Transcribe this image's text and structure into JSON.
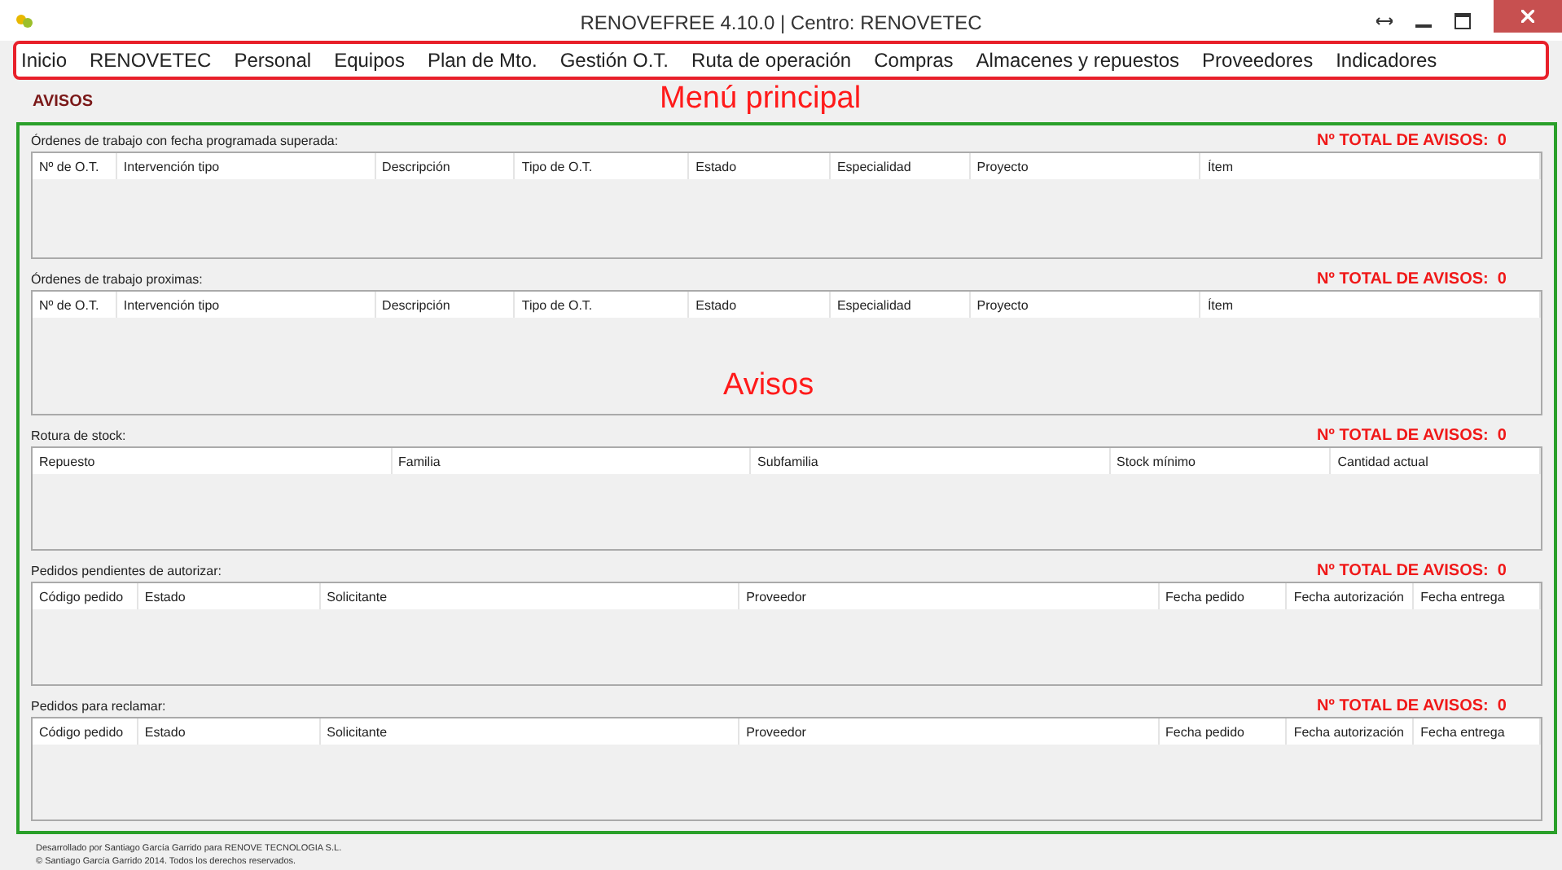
{
  "window": {
    "title": "RENOVEFREE 4.10.0 | Centro: RENOVETEC"
  },
  "menu": [
    "Inicio",
    "RENOVETEC",
    "Personal",
    "Equipos",
    "Plan de Mto.",
    "Gestión O.T.",
    "Ruta de operación",
    "Compras",
    "Almacenes y repuestos",
    "Proveedores",
    "Indicadores"
  ],
  "annotations": {
    "menu": "Menú principal",
    "panel": "Avisos"
  },
  "page_title": "AVISOS",
  "sections": [
    {
      "title": "Órdenes de trabajo con fecha programada superada:",
      "total_label": "Nº TOTAL DE AVISOS:",
      "total": "0",
      "columns": [
        "Nº de O.T.",
        "Intervención tipo",
        "Descripción",
        "Tipo de O.T.",
        "Estado",
        "Especialidad",
        "Proyecto",
        "Ítem"
      ]
    },
    {
      "title": "Órdenes de trabajo proximas:",
      "total_label": "Nº TOTAL DE AVISOS:",
      "total": "0",
      "columns": [
        "Nº de O.T.",
        "Intervención tipo",
        "Descripción",
        "Tipo de O.T.",
        "Estado",
        "Especialidad",
        "Proyecto",
        "Ítem"
      ]
    },
    {
      "title": "Rotura de stock:",
      "total_label": "Nº TOTAL DE AVISOS:",
      "total": "0",
      "columns": [
        "Repuesto",
        "Familia",
        "Subfamilia",
        "Stock mínimo",
        "Cantidad actual"
      ]
    },
    {
      "title": "Pedidos pendientes de autorizar:",
      "total_label": "Nº TOTAL DE AVISOS:",
      "total": "0",
      "columns": [
        "Código pedido",
        "Estado",
        "Solicitante",
        "Proveedor",
        "Fecha pedido",
        "Fecha autorización",
        "Fecha entrega"
      ]
    },
    {
      "title": "Pedidos para reclamar:",
      "total_label": "Nº TOTAL DE AVISOS:",
      "total": "0",
      "columns": [
        "Código pedido",
        "Estado",
        "Solicitante",
        "Proveedor",
        "Fecha pedido",
        "Fecha autorización",
        "Fecha entrega"
      ]
    }
  ],
  "footer": [
    "Desarrollado por Santiago García Garrido para RENOVE TECNOLOGIA S.L.",
    "© Santiago García Garrido 2014. Todos los derechos reservados."
  ]
}
